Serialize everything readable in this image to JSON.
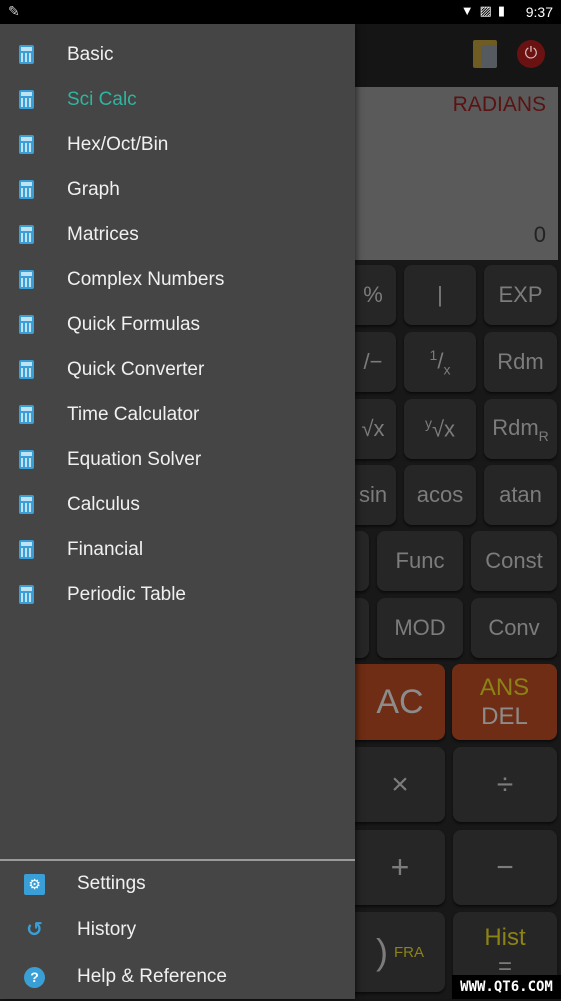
{
  "status_bar": {
    "time": "9:37",
    "icons": [
      "notification-icon",
      "wifi-icon",
      "no-sim-icon",
      "battery-charging-icon"
    ]
  },
  "calculator": {
    "angle_mode": "RADIANS",
    "result": "0",
    "keys": {
      "pct": "%",
      "bar": "|",
      "exp": "EXP",
      "neg": "/−",
      "recip_num": "1",
      "recip_den": "x",
      "rdm": "Rdm",
      "sqrt": "√x",
      "yroot_y": "y",
      "yroot": "√x",
      "rdmr": "Rdm",
      "rdmr_sub": "R",
      "sin": "sin",
      "acos": "acos",
      "atan": "atan",
      "func": "Func",
      "const": "Const",
      "mod": "MOD",
      "conv": "Conv",
      "ac": "AC",
      "ans": "ANS",
      "del": "DEL",
      "mul": "×",
      "div": "÷",
      "plus": "+",
      "minus": "−",
      "paren": ")",
      "fra": "FRA",
      "hist": "Hist",
      "eq": "="
    }
  },
  "drawer": {
    "active_color": "#2fb5a0",
    "items": [
      {
        "label": "Basic"
      },
      {
        "label": "Sci Calc",
        "active": true
      },
      {
        "label": "Hex/Oct/Bin"
      },
      {
        "label": "Graph"
      },
      {
        "label": "Matrices"
      },
      {
        "label": "Complex Numbers"
      },
      {
        "label": "Quick Formulas"
      },
      {
        "label": "Quick Converter"
      },
      {
        "label": "Time Calculator"
      },
      {
        "label": "Equation Solver"
      },
      {
        "label": "Calculus"
      },
      {
        "label": "Financial"
      },
      {
        "label": "Periodic Table"
      }
    ],
    "bottom": [
      {
        "label": "Settings",
        "icon": "settings-icon"
      },
      {
        "label": "History",
        "icon": "history-icon"
      },
      {
        "label": "Help & Reference",
        "icon": "help-icon"
      }
    ]
  },
  "watermark": "WWW.QT6.COM"
}
